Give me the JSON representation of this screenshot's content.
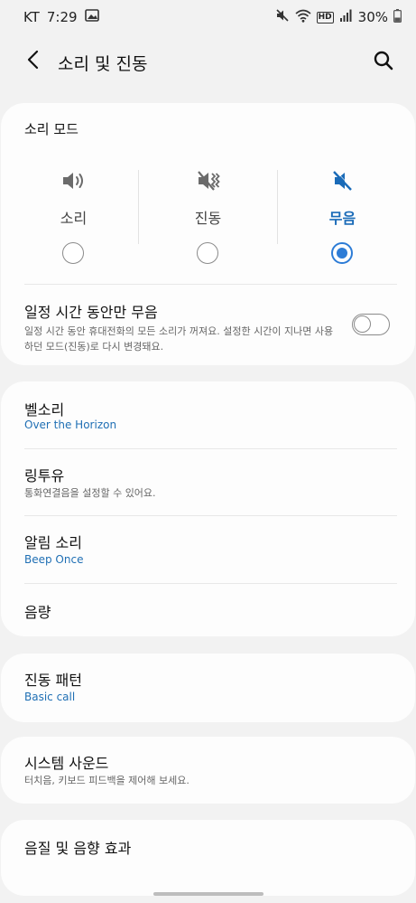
{
  "status_bar": {
    "carrier": "KT",
    "time": "7:29",
    "hd_label": "HD",
    "battery": "30%"
  },
  "app_bar": {
    "title": "소리 및 진동",
    "back_icon": "back-arrow-icon",
    "search_icon": "search-icon"
  },
  "sound_mode": {
    "label": "소리 모드",
    "options": [
      {
        "label": "소리",
        "icon": "speaker-icon",
        "selected": false
      },
      {
        "label": "진동",
        "icon": "vibrate-icon",
        "selected": false
      },
      {
        "label": "무음",
        "icon": "mute-icon",
        "selected": true
      }
    ]
  },
  "temp_mute": {
    "title": "일정 시간 동안만 무음",
    "description": "일정 시간 동안 휴대전화의 모든 소리가 꺼져요. 설정한 시간이 지나면 사용하던 모드(진동)로 다시 변경돼요.",
    "enabled": false
  },
  "settings": {
    "ringtone": {
      "title": "벨소리",
      "value": "Over the Horizon"
    },
    "ringback": {
      "title": "링투유",
      "description": "통화연결음을 설정할 수 있어요."
    },
    "notification": {
      "title": "알림 소리",
      "value": "Beep Once"
    },
    "volume": {
      "title": "음량"
    },
    "vibration_pattern": {
      "title": "진동 패턴",
      "value": "Basic call"
    },
    "system_sound": {
      "title": "시스템 사운드",
      "description": "터치음, 키보드 피드백을 제어해 보세요."
    },
    "sound_quality": {
      "title": "음질 및 음향 효과"
    }
  },
  "colors": {
    "accent": "#2d7cd6",
    "value_text": "#1f6fb4",
    "background": "#f2f2f2",
    "card": "#fdfdfd"
  }
}
